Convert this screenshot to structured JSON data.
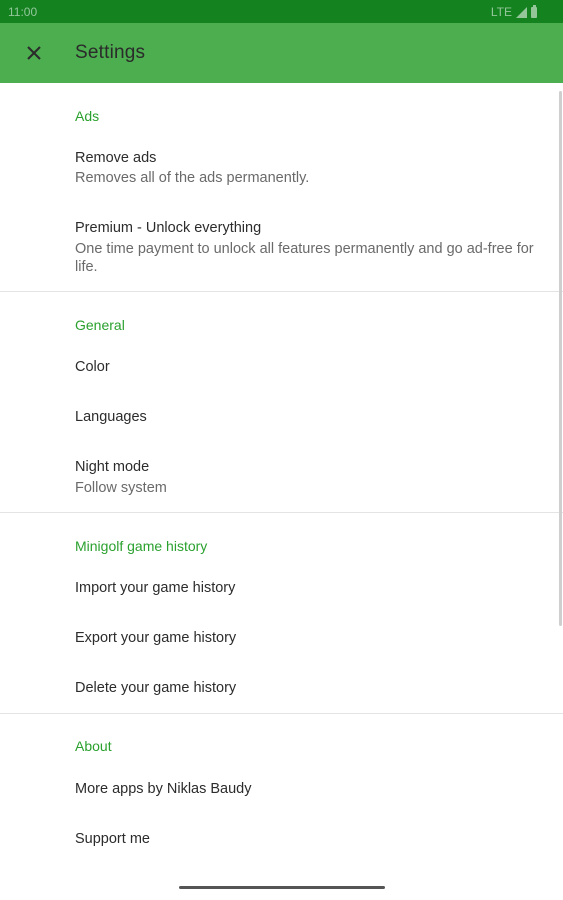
{
  "status_bar": {
    "time": "11:00",
    "network": "LTE"
  },
  "app_bar": {
    "title": "Settings",
    "close_icon": "close-icon",
    "color": "#4cae4f"
  },
  "sections": {
    "ads": {
      "header": "Ads",
      "remove_ads": {
        "title": "Remove ads",
        "summary": "Removes all of the ads permanently."
      },
      "premium": {
        "title": "Premium - Unlock everything",
        "summary": "One time payment to unlock all features permanently and go ad-free for life."
      }
    },
    "general": {
      "header": "General",
      "color": {
        "title": "Color"
      },
      "languages": {
        "title": "Languages"
      },
      "night_mode": {
        "title": "Night mode",
        "summary": "Follow system"
      }
    },
    "history": {
      "header": "Minigolf game history",
      "import": {
        "title": "Import your game history"
      },
      "export": {
        "title": "Export your game history"
      },
      "delete": {
        "title": "Delete your game history"
      }
    },
    "about": {
      "header": "About",
      "more_apps": {
        "title": "More apps by Niklas Baudy"
      },
      "support": {
        "title": "Support me"
      }
    }
  },
  "colors": {
    "status_bar": "#13821f",
    "accent": "#2aa12e"
  }
}
